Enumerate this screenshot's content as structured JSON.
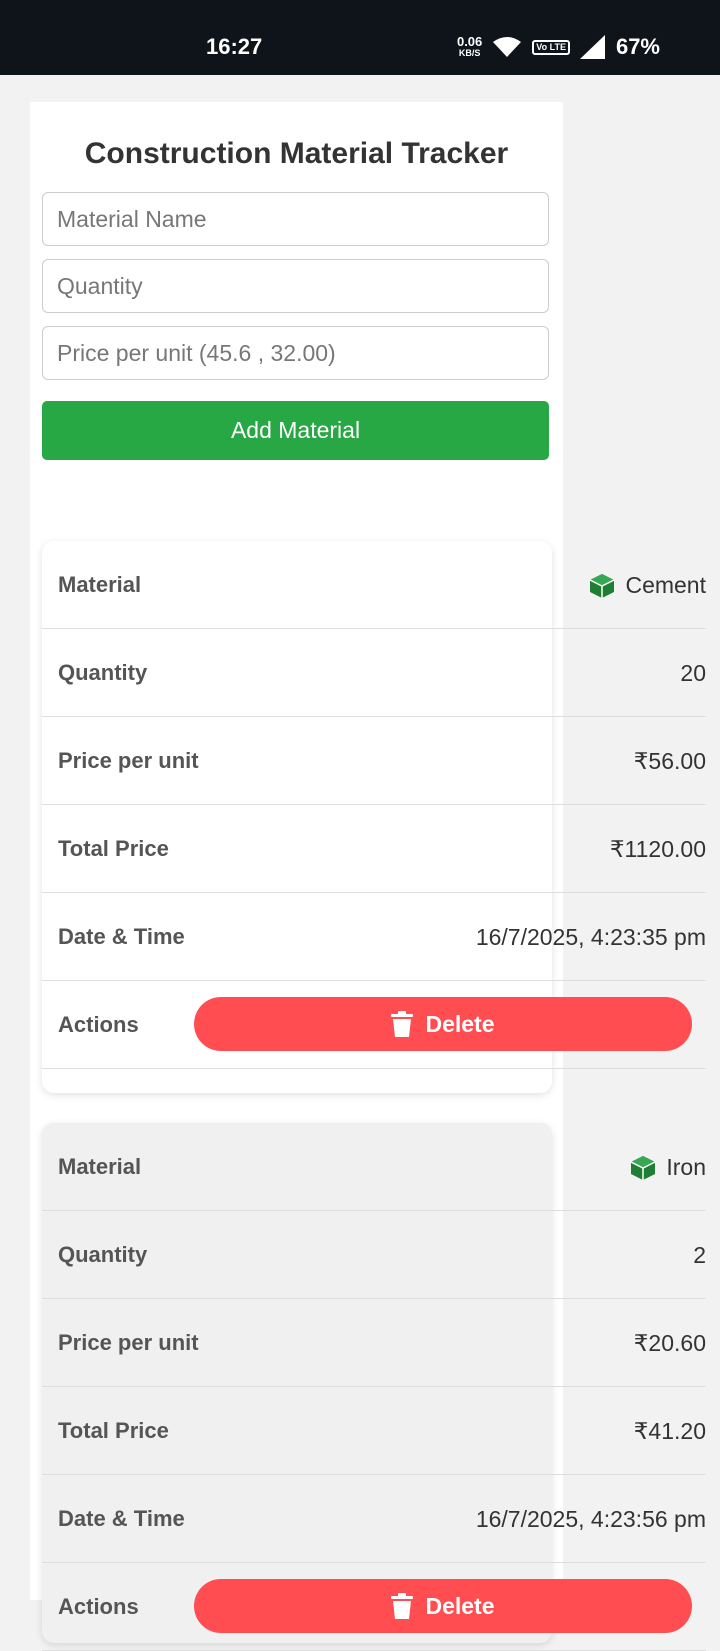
{
  "status_bar": {
    "time": "16:27",
    "net_speed": "0.06",
    "net_unit": "KB/S",
    "volte": "Vo LTE",
    "battery": "67%"
  },
  "app": {
    "title": "Construction Material Tracker",
    "form": {
      "material_placeholder": "Material Name",
      "quantity_placeholder": "Quantity",
      "price_placeholder": "Price per unit (45.6 , 32.00)",
      "add_label": "Add Material"
    },
    "labels": {
      "material": "Material",
      "quantity": "Quantity",
      "price": "Price per unit",
      "total": "Total Price",
      "datetime": "Date & Time",
      "actions": "Actions",
      "delete": "Delete"
    },
    "materials": [
      {
        "name": "Cement",
        "quantity": "20",
        "price": "₹56.00",
        "total": "₹1120.00",
        "datetime": "16/7/2025, 4:23:35 pm"
      },
      {
        "name": "Iron",
        "quantity": "2",
        "price": "₹20.60",
        "total": "₹41.20",
        "datetime": "16/7/2025, 4:23:56 pm"
      }
    ]
  },
  "colors": {
    "accent_green": "#28a745",
    "delete_red": "#ff4d52",
    "icon_green": "#1e7e34"
  }
}
